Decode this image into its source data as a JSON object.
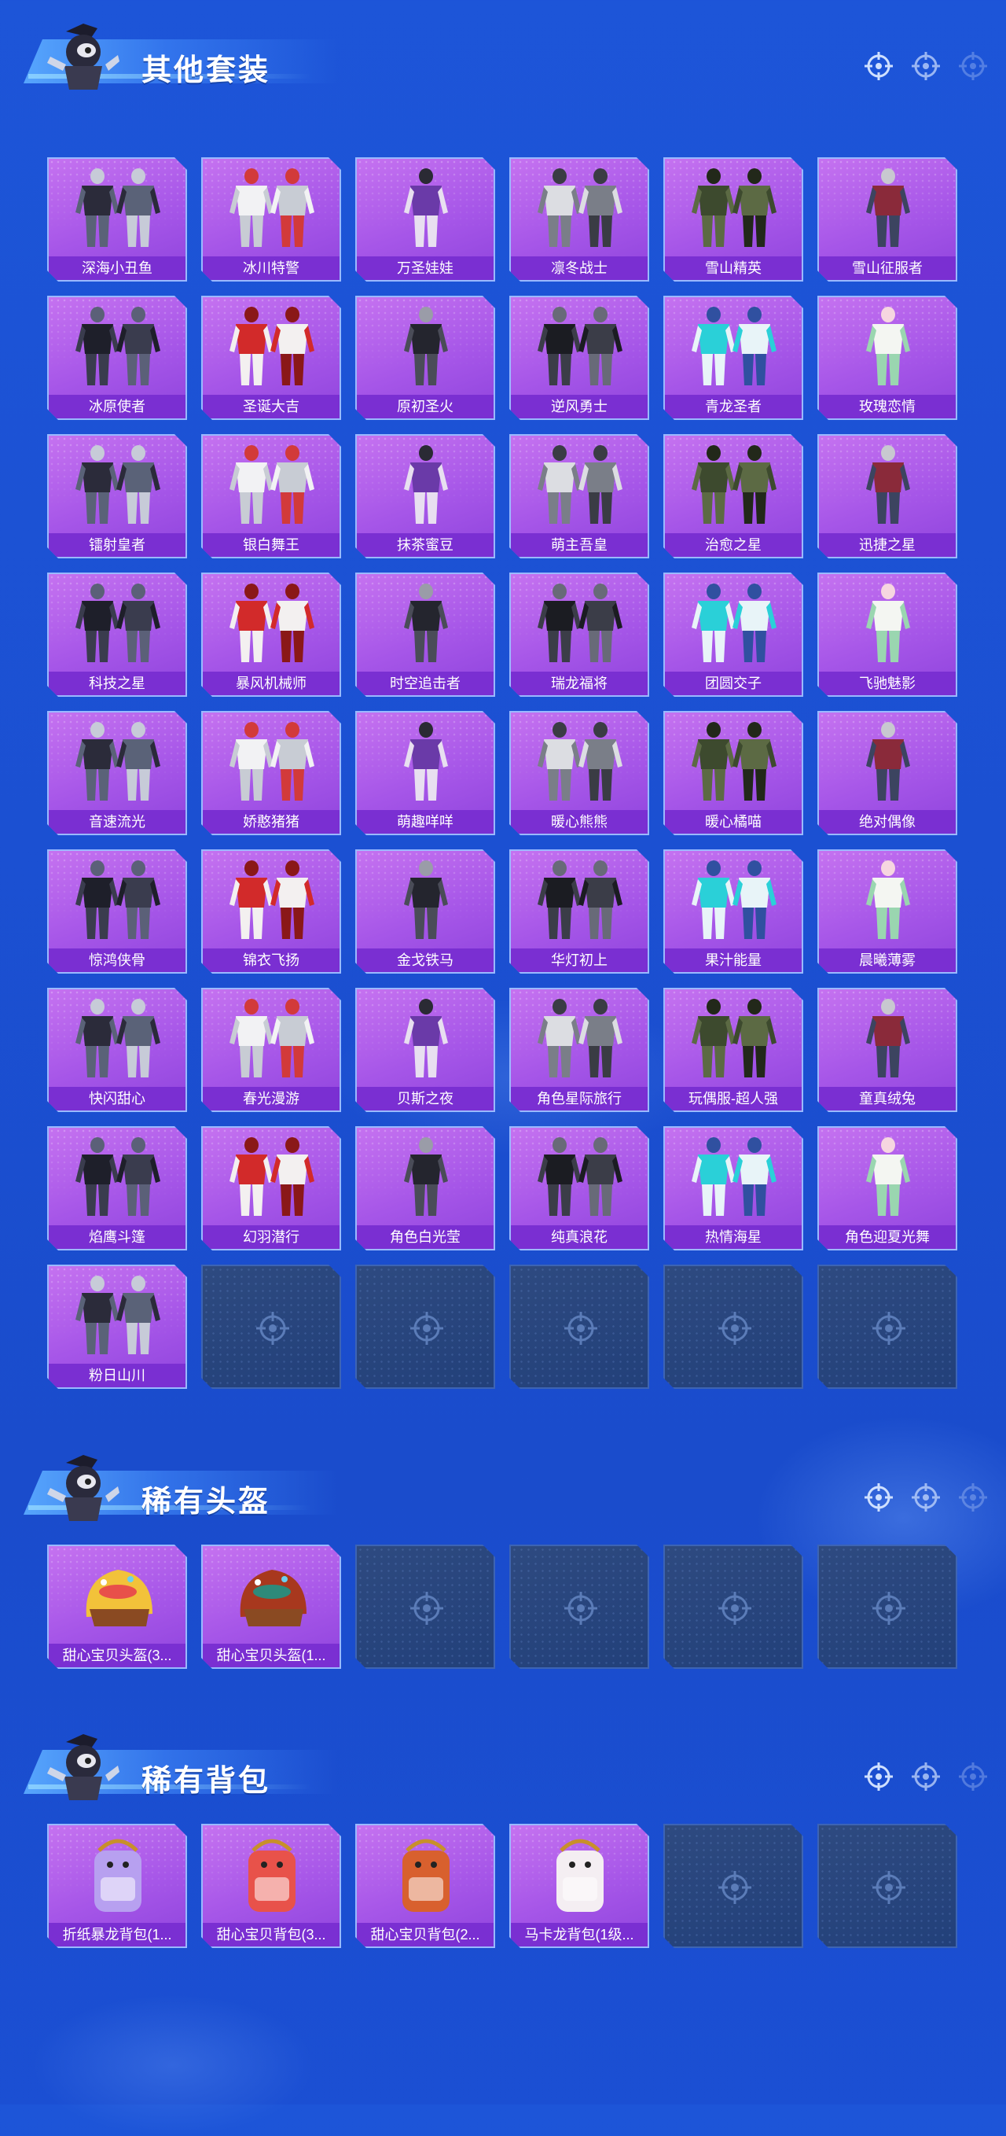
{
  "colors": {
    "background": "#1b50d2",
    "card_purple": "#a656e8",
    "label_bar": "#7a2fd2",
    "empty_slot": "#22407a"
  },
  "sections": [
    {
      "title": "其他套装",
      "items": [
        "深海小丑鱼",
        "冰川特警",
        "万圣娃娃",
        "凛冬战士",
        "雪山精英",
        "雪山征服者",
        "冰原使者",
        "圣诞大吉",
        "原初圣火",
        "逆风勇士",
        "青龙圣者",
        "玫瑰恋情",
        "镭射皇者",
        "银白舞王",
        "抹茶蜜豆",
        "萌主吾皇",
        "治愈之星",
        "迅捷之星",
        "科技之星",
        "暴风机械师",
        "时空追击者",
        "瑞龙福将",
        "团圆交子",
        "飞驰魅影",
        "音速流光",
        "娇憨猪猪",
        "萌趣咩咩",
        "暖心熊熊",
        "暖心橘喵",
        "绝对偶像",
        "惊鸿侠骨",
        "锦衣飞扬",
        "金戈铁马",
        "华灯初上",
        "果汁能量",
        "晨曦薄雾",
        "快闪甜心",
        "春光漫游",
        "贝斯之夜",
        "角色星际旅行",
        "玩偶服-超人强",
        "童真绒兔",
        "焰鹰斗篷",
        "幻羽潜行",
        "角色白光莹",
        "纯真浪花",
        "热情海星",
        "角色迎夏光舞",
        "粉日山川"
      ],
      "empty_slots": 5
    },
    {
      "title": "稀有头盔",
      "items": [
        "甜心宝贝头盔(3...",
        "甜心宝贝头盔(1..."
      ],
      "empty_slots": 4
    },
    {
      "title": "稀有背包",
      "items": [
        "折纸暴龙背包(1...",
        "甜心宝贝背包(3...",
        "甜心宝贝背包(2...",
        "马卡龙背包(1级..."
      ],
      "empty_slots": 2
    }
  ]
}
